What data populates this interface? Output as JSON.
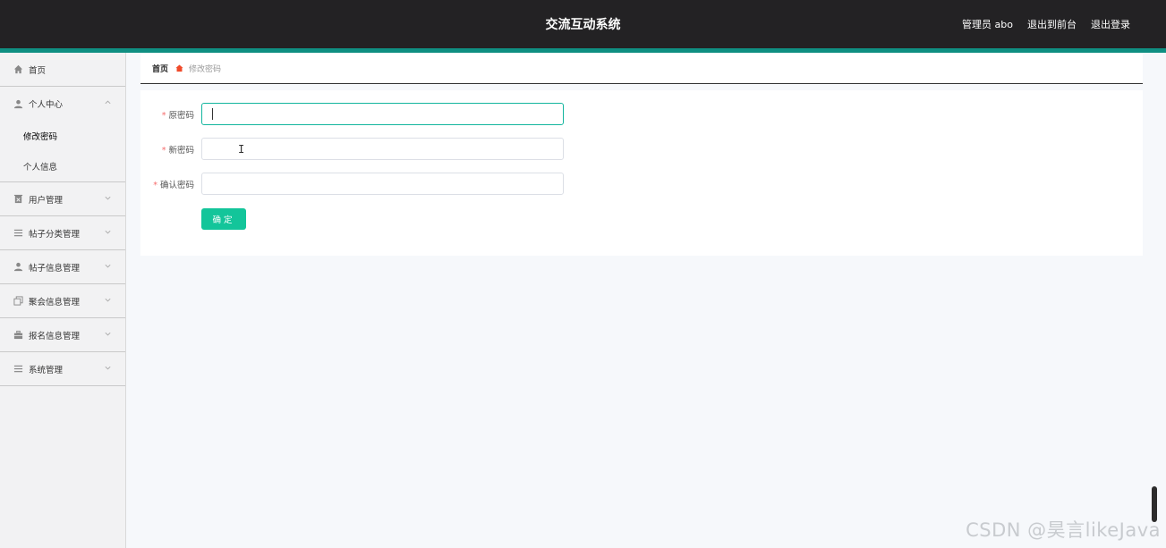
{
  "header": {
    "title": "交流互动系统",
    "user_label": "管理员 abo",
    "to_front": "退出到前台",
    "logout": "退出登录"
  },
  "sidebar": {
    "home": "首页",
    "personal_center": {
      "label": "个人中心",
      "children": [
        "修改密码",
        "个人信息"
      ]
    },
    "items": [
      {
        "label": "用户管理",
        "icon": "delete-box-icon"
      },
      {
        "label": "帖子分类管理",
        "icon": "list-icon"
      },
      {
        "label": "帖子信息管理",
        "icon": "user-icon"
      },
      {
        "label": "聚会信息管理",
        "icon": "copy-icon"
      },
      {
        "label": "报名信息管理",
        "icon": "briefcase-icon"
      },
      {
        "label": "系统管理",
        "icon": "list-icon"
      }
    ]
  },
  "breadcrumb": {
    "home": "首页",
    "current": "修改密码"
  },
  "form": {
    "old_password_label": "原密码",
    "new_password_label": "新密码",
    "confirm_password_label": "确认密码",
    "old_password_value": "",
    "new_password_value": "",
    "confirm_password_value": "",
    "submit_label": "确定"
  },
  "watermark": "CSDN @昊言likeJava",
  "colors": {
    "header_bg": "#232224",
    "accent": "#0f8f82",
    "button": "#13c59a",
    "required": "#f56c6c"
  }
}
